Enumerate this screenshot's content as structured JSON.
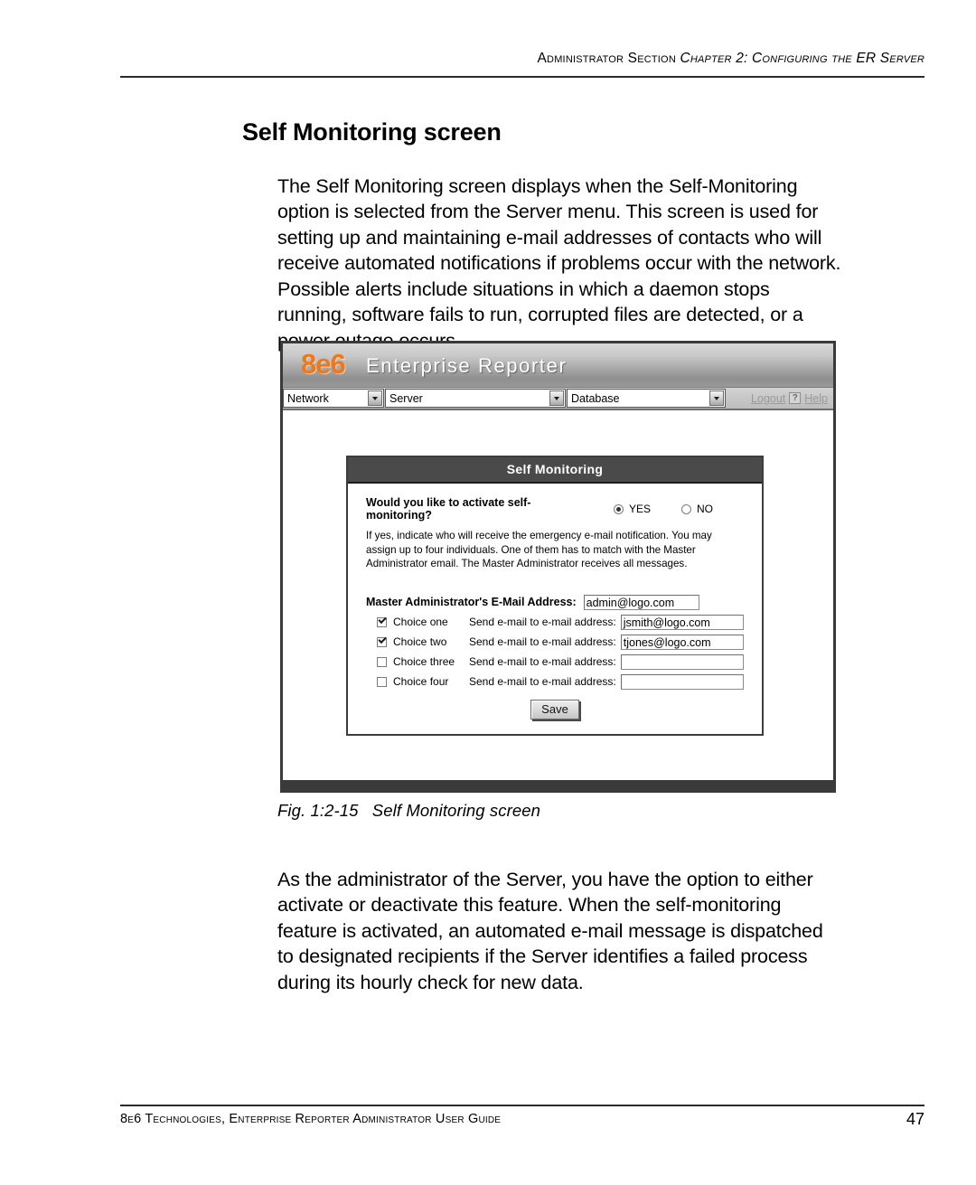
{
  "header": {
    "section": "Administrator Section",
    "chapter": "Chapter 2: Configuring the ER Server"
  },
  "section_title": "Self Monitoring screen",
  "paragraphs": {
    "intro": "The Self Monitoring screen displays when the Self-Monitoring option is selected from the Server menu. This screen is used for setting up and maintaining e-mail addresses of contacts who will receive automated notifications if problems occur with the network. Possible alerts include situations in which a daemon stops running, software fails to run, corrupted files are detected, or a power outage occurs.",
    "outro": "As the administrator of the Server, you have the option to either activate or deactivate this feature. When the self-monitoring feature is activated, an automated e-mail message is dispatched to designated recipients if the Server identifies a failed process during its hourly check for new data."
  },
  "figure": {
    "number": "Fig. 1:2-15",
    "caption": "Self Monitoring screen"
  },
  "screenshot": {
    "banner": {
      "logo": "8e6",
      "product": "Enterprise Reporter",
      "logo_color": "#f07818"
    },
    "toolbar": {
      "menus": [
        {
          "label": "Network"
        },
        {
          "label": "Server"
        },
        {
          "label": "Database"
        }
      ],
      "logout_label": "Logout",
      "help_label": "Help",
      "help_icon_glyph": "?"
    },
    "panel": {
      "title": "Self Monitoring",
      "question": "Would you like to activate self-monitoring?",
      "options": [
        {
          "label": "YES",
          "selected": true
        },
        {
          "label": "NO",
          "selected": false
        }
      ],
      "note": "If yes, indicate who will receive the emergency e-mail notification. You may assign up to four individuals. One of them has to match with the Master Administrator email. The Master Administrator receives all messages.",
      "master_label": "Master Administrator's E-Mail Address:",
      "master_email": "admin@logo.com",
      "send_label": "Send e-mail to e-mail address:",
      "choices": [
        {
          "label": "Choice one",
          "checked": true,
          "email": "jsmith@logo.com"
        },
        {
          "label": "Choice two",
          "checked": true,
          "email": "tjones@logo.com"
        },
        {
          "label": "Choice three",
          "checked": false,
          "email": ""
        },
        {
          "label": "Choice four",
          "checked": false,
          "email": ""
        }
      ],
      "save_label": "Save"
    }
  },
  "footer": {
    "text": "8e6 Technologies, Enterprise Reporter Administrator User Guide",
    "page": "47"
  }
}
